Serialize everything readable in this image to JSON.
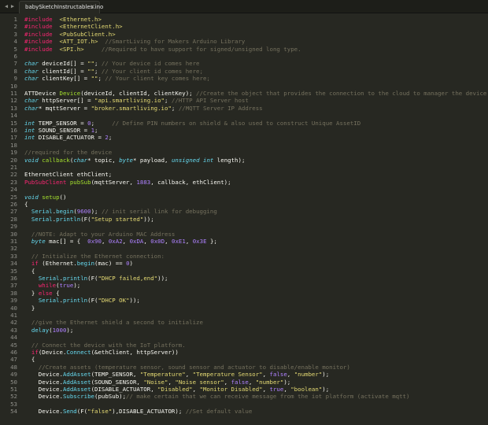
{
  "tab": {
    "title": "babySketchInstructables.ino"
  },
  "icons": {
    "nav_left": "◀",
    "nav_right": "▶",
    "close": "×"
  },
  "colors": {
    "background": "#272822",
    "keyword": "#f92672",
    "string": "#e6db74",
    "comment": "#75715e",
    "number": "#ae81ff",
    "function": "#66d9ef",
    "class": "#a6e22e"
  },
  "lines": [
    {
      "n": "1",
      "t": [
        [
          "kw",
          "#include"
        ],
        [
          "",
          "  "
        ],
        [
          "st",
          "<Ethernet.h>"
        ]
      ]
    },
    {
      "n": "2",
      "t": [
        [
          "kw",
          "#include"
        ],
        [
          "",
          "  "
        ],
        [
          "st",
          "<EthernetClient.h>"
        ]
      ]
    },
    {
      "n": "3",
      "t": [
        [
          "kw",
          "#include"
        ],
        [
          "",
          "  "
        ],
        [
          "st",
          "<PubSubClient.h>"
        ]
      ]
    },
    {
      "n": "4",
      "t": [
        [
          "kw",
          "#include"
        ],
        [
          "",
          "  "
        ],
        [
          "st",
          "<ATT_IOT.h>"
        ],
        [
          "",
          "  "
        ],
        [
          "cm",
          "//SmartLiving for Makers Arduino Library"
        ]
      ]
    },
    {
      "n": "5",
      "t": [
        [
          "kw",
          "#include"
        ],
        [
          "",
          "  "
        ],
        [
          "st",
          "<SPI.h>"
        ],
        [
          "",
          "     "
        ],
        [
          "cm",
          "//Required to have support for signed/unsigned long type."
        ]
      ]
    },
    {
      "n": "6",
      "t": []
    },
    {
      "n": "7",
      "t": [
        [
          "ty",
          "char"
        ],
        [
          "",
          " deviceId[] = "
        ],
        [
          "st",
          "\"\""
        ],
        [
          "",
          "; "
        ],
        [
          "cm",
          "// Your device id comes here"
        ]
      ]
    },
    {
      "n": "8",
      "t": [
        [
          "ty",
          "char"
        ],
        [
          "",
          " clientId[] = "
        ],
        [
          "st",
          "\"\""
        ],
        [
          "",
          "; "
        ],
        [
          "cm",
          "// Your client id comes here;"
        ]
      ]
    },
    {
      "n": "9",
      "t": [
        [
          "ty",
          "char"
        ],
        [
          "",
          " clientKey[] = "
        ],
        [
          "st",
          "\"\""
        ],
        [
          "",
          "; "
        ],
        [
          "cm",
          "// Your client key comes here;"
        ]
      ]
    },
    {
      "n": "10",
      "t": []
    },
    {
      "n": "11",
      "t": [
        [
          "",
          "ATTDevice "
        ],
        [
          "cl",
          "Device"
        ],
        [
          "",
          "(deviceId, clientId, clientKey); "
        ],
        [
          "cm",
          "//Create the object that provides the connection to the cloud to manager the device."
        ]
      ]
    },
    {
      "n": "12",
      "t": [
        [
          "ty",
          "char"
        ],
        [
          "",
          " httpServer[] = "
        ],
        [
          "st",
          "\"api.smartliving.io\""
        ],
        [
          "",
          "; "
        ],
        [
          "cm",
          "//HTTP API Server host"
        ]
      ]
    },
    {
      "n": "13",
      "t": [
        [
          "ty",
          "char"
        ],
        [
          "",
          "* mqttServer = "
        ],
        [
          "st",
          "\"broker.smartliving.io\""
        ],
        [
          "",
          "; "
        ],
        [
          "cm",
          "//MQTT Server IP Address"
        ]
      ]
    },
    {
      "n": "14",
      "t": []
    },
    {
      "n": "15",
      "t": [
        [
          "ty",
          "int"
        ],
        [
          "",
          " TEMP_SENSOR = "
        ],
        [
          "nu",
          "0"
        ],
        [
          "",
          ";     "
        ],
        [
          "cm",
          "// Define PIN numbers on shield & also used to construct Unique AssetID"
        ]
      ]
    },
    {
      "n": "16",
      "t": [
        [
          "ty",
          "int"
        ],
        [
          "",
          " SOUND_SENSOR = "
        ],
        [
          "nu",
          "1"
        ],
        [
          "",
          ";"
        ]
      ]
    },
    {
      "n": "17",
      "t": [
        [
          "ty",
          "int"
        ],
        [
          "",
          " DISABLE_ACTUATOR = "
        ],
        [
          "nu",
          "2"
        ],
        [
          "",
          ";"
        ]
      ]
    },
    {
      "n": "18",
      "t": []
    },
    {
      "n": "19",
      "t": [
        [
          "cm",
          "//required for the device"
        ]
      ]
    },
    {
      "n": "20",
      "t": [
        [
          "ty",
          "void"
        ],
        [
          "",
          " "
        ],
        [
          "cl",
          "callback"
        ],
        [
          "",
          "("
        ],
        [
          "ty",
          "char"
        ],
        [
          "",
          "* topic, "
        ],
        [
          "ty",
          "byte"
        ],
        [
          "",
          "* payload, "
        ],
        [
          "ty",
          "unsigned int"
        ],
        [
          "",
          " length);"
        ]
      ]
    },
    {
      "n": "21",
      "t": []
    },
    {
      "n": "22",
      "t": [
        [
          "",
          "EthernetClient ethClient;"
        ]
      ]
    },
    {
      "n": "23",
      "t": [
        [
          "kw",
          "PubSubClient"
        ],
        [
          "",
          " "
        ],
        [
          "cl",
          "pubSub"
        ],
        [
          "",
          "(mqttServer, "
        ],
        [
          "nu",
          "1883"
        ],
        [
          "",
          ", callback, ethClient);"
        ]
      ]
    },
    {
      "n": "24",
      "t": []
    },
    {
      "n": "25",
      "t": [
        [
          "ty",
          "void"
        ],
        [
          "",
          " "
        ],
        [
          "cl",
          "setup"
        ],
        [
          "",
          "()"
        ]
      ]
    },
    {
      "n": "26",
      "t": [
        [
          "",
          "{"
        ]
      ]
    },
    {
      "n": "27",
      "t": [
        [
          "",
          "  "
        ],
        [
          "fn",
          "Serial"
        ],
        [
          "",
          "."
        ],
        [
          "fn",
          "begin"
        ],
        [
          "",
          "("
        ],
        [
          "nu",
          "9600"
        ],
        [
          "",
          "); "
        ],
        [
          "cm",
          "// init serial link for debugging"
        ]
      ]
    },
    {
      "n": "28",
      "t": [
        [
          "",
          "  "
        ],
        [
          "fn",
          "Serial"
        ],
        [
          "",
          "."
        ],
        [
          "fn",
          "println"
        ],
        [
          "",
          "(F("
        ],
        [
          "st",
          "\"Setup started\""
        ],
        [
          "",
          "));"
        ]
      ]
    },
    {
      "n": "29",
      "t": []
    },
    {
      "n": "30",
      "t": [
        [
          "",
          "  "
        ],
        [
          "cm",
          "//NOTE: Adapt to your Arduino MAC Address"
        ]
      ]
    },
    {
      "n": "31",
      "t": [
        [
          "",
          "  "
        ],
        [
          "ty",
          "byte"
        ],
        [
          "",
          " mac[] = {  "
        ],
        [
          "nu",
          "0x90"
        ],
        [
          "",
          ", "
        ],
        [
          "nu",
          "0xA2"
        ],
        [
          "",
          ", "
        ],
        [
          "nu",
          "0xDA"
        ],
        [
          "",
          ", "
        ],
        [
          "nu",
          "0x0D"
        ],
        [
          "",
          ", "
        ],
        [
          "nu",
          "0xE1"
        ],
        [
          "",
          ", "
        ],
        [
          "nu",
          "0x3E"
        ],
        [
          "",
          " };"
        ]
      ]
    },
    {
      "n": "32",
      "t": []
    },
    {
      "n": "33",
      "t": [
        [
          "",
          "  "
        ],
        [
          "cm",
          "// Initialize the Ethernet connection:"
        ]
      ]
    },
    {
      "n": "34",
      "t": [
        [
          "",
          "  "
        ],
        [
          "kw",
          "if"
        ],
        [
          "",
          " (Ethernet."
        ],
        [
          "fn",
          "begin"
        ],
        [
          "",
          "(mac) == "
        ],
        [
          "nu",
          "0"
        ],
        [
          "",
          ")"
        ]
      ]
    },
    {
      "n": "35",
      "t": [
        [
          "",
          "  {"
        ]
      ]
    },
    {
      "n": "36",
      "t": [
        [
          "",
          "    "
        ],
        [
          "fn",
          "Serial"
        ],
        [
          "",
          "."
        ],
        [
          "fn",
          "println"
        ],
        [
          "",
          "(F("
        ],
        [
          "st",
          "\"DHCP failed,end\""
        ],
        [
          "",
          "));"
        ]
      ]
    },
    {
      "n": "37",
      "t": [
        [
          "",
          "    "
        ],
        [
          "kw",
          "while"
        ],
        [
          "",
          "("
        ],
        [
          "nu",
          "true"
        ],
        [
          "",
          "); "
        ]
      ]
    },
    {
      "n": "38",
      "t": [
        [
          "",
          "  } "
        ],
        [
          "kw",
          "else"
        ],
        [
          "",
          " {"
        ]
      ]
    },
    {
      "n": "39",
      "t": [
        [
          "",
          "    "
        ],
        [
          "fn",
          "Serial"
        ],
        [
          "",
          "."
        ],
        [
          "fn",
          "println"
        ],
        [
          "",
          "(F("
        ],
        [
          "st",
          "\"DHCP OK\""
        ],
        [
          "",
          "));"
        ]
      ]
    },
    {
      "n": "40",
      "t": [
        [
          "",
          "  }"
        ]
      ]
    },
    {
      "n": "41",
      "t": []
    },
    {
      "n": "42",
      "t": [
        [
          "",
          "  "
        ],
        [
          "cm",
          "//give the Ethernet shield a second to initialize"
        ]
      ]
    },
    {
      "n": "43",
      "t": [
        [
          "",
          "  "
        ],
        [
          "fn",
          "delay"
        ],
        [
          "",
          "("
        ],
        [
          "nu",
          "1000"
        ],
        [
          "",
          "); "
        ]
      ]
    },
    {
      "n": "44",
      "t": []
    },
    {
      "n": "45",
      "t": [
        [
          "",
          "  "
        ],
        [
          "cm",
          "// Connect the device with the IoT platform."
        ]
      ]
    },
    {
      "n": "46",
      "t": [
        [
          "",
          "  "
        ],
        [
          "kw",
          "if"
        ],
        [
          "",
          "(Device."
        ],
        [
          "fn",
          "Connect"
        ],
        [
          "",
          "(&ethClient, httpServer))"
        ]
      ]
    },
    {
      "n": "47",
      "t": [
        [
          "",
          "  {"
        ]
      ]
    },
    {
      "n": "48",
      "t": [
        [
          "",
          "    "
        ],
        [
          "cm",
          "//Create assets (temperature sensor, sound sensor and actuator to disable/enable monitor)"
        ]
      ]
    },
    {
      "n": "49",
      "t": [
        [
          "",
          "    Device."
        ],
        [
          "fn",
          "AddAsset"
        ],
        [
          "",
          "(TEMP_SENSOR, "
        ],
        [
          "st",
          "\"Temperature\""
        ],
        [
          "",
          ", "
        ],
        [
          "st",
          "\"Temperature Sensor\""
        ],
        [
          "",
          ", "
        ],
        [
          "nu",
          "false"
        ],
        [
          "",
          ", "
        ],
        [
          "st",
          "\"number\""
        ],
        [
          "",
          "); "
        ]
      ]
    },
    {
      "n": "50",
      "t": [
        [
          "",
          "    Device."
        ],
        [
          "fn",
          "AddAsset"
        ],
        [
          "",
          "(SOUND_SENSOR, "
        ],
        [
          "st",
          "\"Noise\""
        ],
        [
          "",
          ", "
        ],
        [
          "st",
          "\"Noise sensor\""
        ],
        [
          "",
          ", "
        ],
        [
          "nu",
          "false"
        ],
        [
          "",
          ", "
        ],
        [
          "st",
          "\"number\""
        ],
        [
          "",
          "); "
        ]
      ]
    },
    {
      "n": "51",
      "t": [
        [
          "",
          "    Device."
        ],
        [
          "fn",
          "AddAsset"
        ],
        [
          "",
          "(DISABLE_ACTUATOR, "
        ],
        [
          "st",
          "\"Disabled\""
        ],
        [
          "",
          ", "
        ],
        [
          "st",
          "\"Monitor Disabled\""
        ],
        [
          "",
          ", "
        ],
        [
          "nu",
          "true"
        ],
        [
          "",
          ", "
        ],
        [
          "st",
          "\"boolean\""
        ],
        [
          "",
          "); "
        ]
      ]
    },
    {
      "n": "52",
      "t": [
        [
          "",
          "    Device."
        ],
        [
          "fn",
          "Subscribe"
        ],
        [
          "",
          "(pubSub);"
        ],
        [
          "cm",
          "// make certain that we can receive message from the iot platform (activate mqtt)"
        ]
      ]
    },
    {
      "n": "53",
      "t": []
    },
    {
      "n": "54",
      "t": [
        [
          "",
          "    Device."
        ],
        [
          "fn",
          "Send"
        ],
        [
          "",
          "(F("
        ],
        [
          "st",
          "\"false\""
        ],
        [
          "",
          "),DISABLE_ACTUATOR); "
        ],
        [
          "cm",
          "//Set default value"
        ]
      ]
    }
  ]
}
